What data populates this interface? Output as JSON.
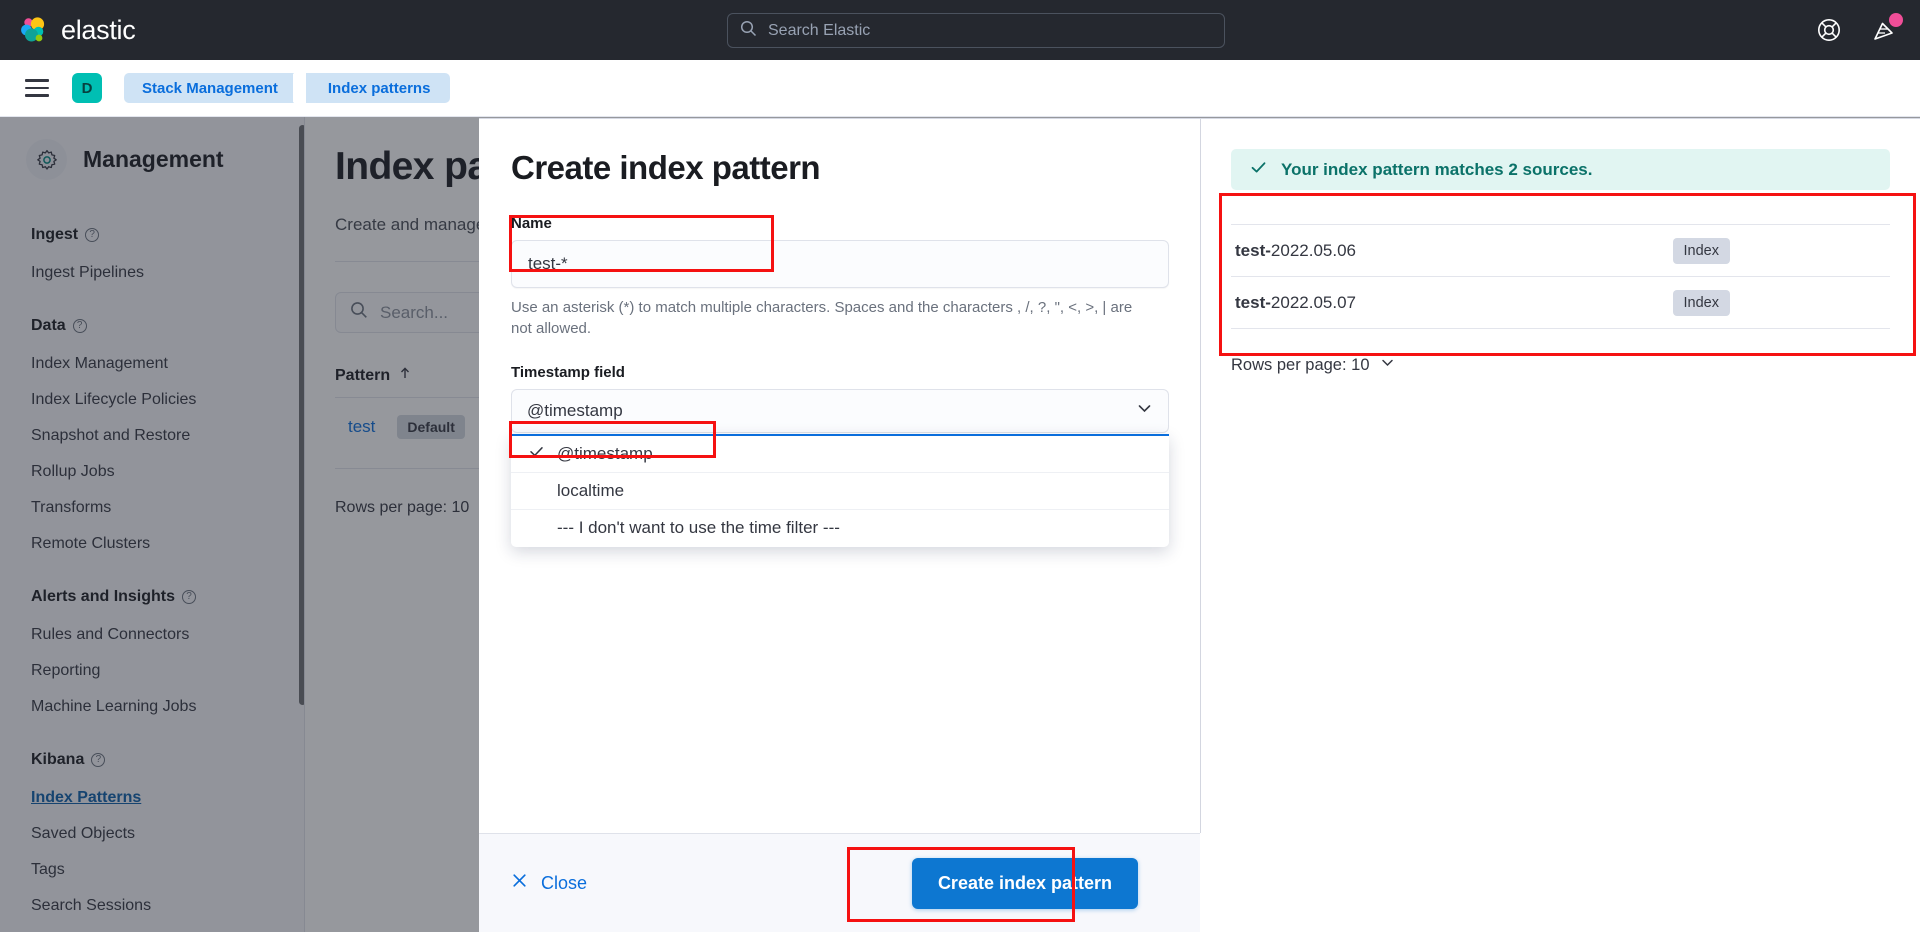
{
  "topnav": {
    "brand": "elastic",
    "search_placeholder": "Search Elastic",
    "search_icon": "search-icon",
    "help_icon": "help-lifebuoy-icon",
    "news_icon": "news-announcement-icon"
  },
  "breadcrumb": {
    "menu_icon": "hamburger-menu-icon",
    "space_initial": "D",
    "items": [
      {
        "label": "Stack Management"
      },
      {
        "label": "Index patterns"
      }
    ]
  },
  "sidebar": {
    "title": "Management",
    "gear_icon": "gear-icon",
    "groups": [
      {
        "title": "Ingest",
        "items": [
          {
            "label": "Ingest Pipelines",
            "active": false
          }
        ]
      },
      {
        "title": "Data",
        "items": [
          {
            "label": "Index Management",
            "active": false
          },
          {
            "label": "Index Lifecycle Policies",
            "active": false
          },
          {
            "label": "Snapshot and Restore",
            "active": false
          },
          {
            "label": "Rollup Jobs",
            "active": false
          },
          {
            "label": "Transforms",
            "active": false
          },
          {
            "label": "Remote Clusters",
            "active": false
          }
        ]
      },
      {
        "title": "Alerts and Insights",
        "items": [
          {
            "label": "Rules and Connectors",
            "active": false
          },
          {
            "label": "Reporting",
            "active": false
          },
          {
            "label": "Machine Learning Jobs",
            "active": false
          }
        ]
      },
      {
        "title": "Kibana",
        "items": [
          {
            "label": "Index Patterns",
            "active": true
          },
          {
            "label": "Saved Objects",
            "active": false
          },
          {
            "label": "Tags",
            "active": false
          },
          {
            "label": "Search Sessions",
            "active": false
          }
        ]
      }
    ]
  },
  "page": {
    "title": "Index patterns",
    "subtitle": "Create and manage the index patterns that help you retrieve your data from Elasticsearch.",
    "search_placeholder": "Search...",
    "table_header": "Pattern",
    "sort_icon": "sort-ascending-arrow-icon",
    "rows": [
      {
        "name": "test",
        "tag": "Default"
      }
    ],
    "rows_per_page": "Rows per page: 10"
  },
  "flyout": {
    "title": "Create index pattern",
    "name_label": "Name",
    "name_value": "test-*",
    "name_help": "Use an asterisk (*) to match multiple characters. Spaces and the characters , /, ?, \", <, >, | are not allowed.",
    "timestamp_label": "Timestamp field",
    "timestamp_value": "@timestamp",
    "chevron_icon": "chevron-down-icon",
    "options": [
      {
        "label": "@timestamp",
        "selected": true
      },
      {
        "label": "localtime",
        "selected": false
      },
      {
        "label": "--- I don't want to use the time filter ---",
        "selected": false
      }
    ],
    "footer": {
      "close_label": "Close",
      "close_icon": "close-x-icon",
      "create_label": "Create index pattern"
    }
  },
  "matches": {
    "callout_text": "Your index pattern matches 2 sources.",
    "callout_icon": "check-icon",
    "sources": [
      {
        "prefix": "test-",
        "suffix": "2022.05.06",
        "badge": "Index"
      },
      {
        "prefix": "test-",
        "suffix": "2022.05.07",
        "badge": "Index"
      }
    ],
    "rows_per_page": "Rows per page: 10",
    "rows_per_page_icon": "chevron-down-icon"
  },
  "colors": {
    "brand_dark": "#25282f",
    "accent_blue": "#0a6edc",
    "primary_button": "#0d77d1",
    "success_teal": "#0b7269",
    "callout_bg": "#e1f5f2",
    "annotation_red": "#f51111",
    "space_avatar": "#00bfb3",
    "notification_pink": "#f04e98"
  }
}
